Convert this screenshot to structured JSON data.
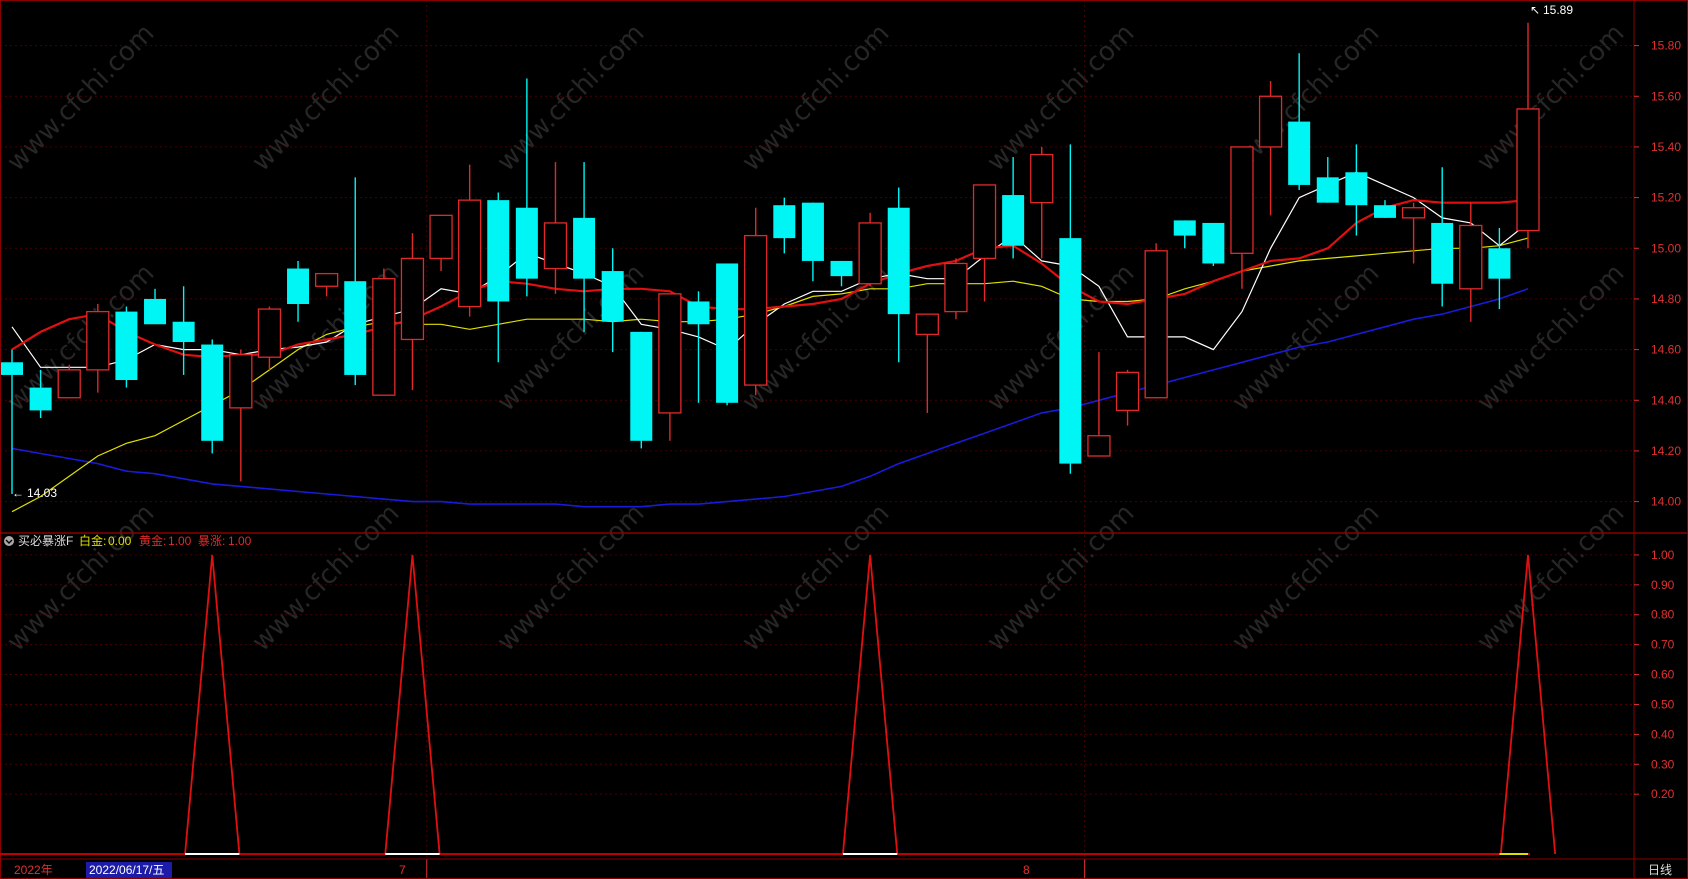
{
  "watermark": "www.cfchi.com",
  "colors": {
    "up": "#e02a2a",
    "down": "#00f5f5",
    "frame": "#8a0000",
    "grid": "#4a0000",
    "ma5": "#ffffff",
    "ma10": "#e01010",
    "ma20": "#e0e000",
    "ma60": "#1a1adb",
    "sig_line": "#e01010",
    "base_line": "#c00000"
  },
  "price_panel": {
    "y_ticks": [
      "15.80",
      "15.60",
      "15.40",
      "15.20",
      "15.00",
      "14.80",
      "14.60",
      "14.40",
      "14.20",
      "14.00"
    ],
    "y_range": [
      13.88,
      15.98
    ],
    "high_annotation": "15.89",
    "low_annotation": "14.03"
  },
  "indicator": {
    "name": "买必暴涨F",
    "items": [
      {
        "label": "白金:",
        "value": "0.00",
        "color": "#e0e000"
      },
      {
        "label": "黄金:",
        "value": "1.00",
        "color": "#e02a2a"
      },
      {
        "label": "暴涨:",
        "value": "1.00",
        "color": "#e02a2a"
      }
    ],
    "y_ticks": [
      "1.00",
      "0.90",
      "0.80",
      "0.70",
      "0.60",
      "0.50",
      "0.40",
      "0.30",
      "0.20"
    ],
    "y_range": [
      0,
      1.07
    ]
  },
  "x_axis": {
    "year_label": "2022年",
    "selected_date": "2022/06/17/五",
    "month_labels": [
      {
        "text": "7",
        "index": 15
      },
      {
        "text": "8",
        "index": 38
      }
    ],
    "period_button": "日线"
  },
  "chart_data": [
    {
      "type": "candlestick",
      "title": "",
      "ylim": [
        13.88,
        15.98
      ],
      "ohlc": [
        [
          14.55,
          14.6,
          14.03,
          14.5
        ],
        [
          14.45,
          14.52,
          14.33,
          14.36
        ],
        [
          14.41,
          14.54,
          14.41,
          14.52
        ],
        [
          14.52,
          14.78,
          14.43,
          14.75
        ],
        [
          14.75,
          14.77,
          14.45,
          14.48
        ],
        [
          14.8,
          14.84,
          14.72,
          14.7
        ],
        [
          14.71,
          14.85,
          14.5,
          14.63
        ],
        [
          14.62,
          14.64,
          14.19,
          14.24
        ],
        [
          14.37,
          14.6,
          14.08,
          14.58
        ],
        [
          14.57,
          14.77,
          14.52,
          14.76
        ],
        [
          14.92,
          14.95,
          14.71,
          14.78
        ],
        [
          14.85,
          14.9,
          14.81,
          14.9
        ],
        [
          14.87,
          15.28,
          14.46,
          14.5
        ],
        [
          14.42,
          14.92,
          14.42,
          14.88
        ],
        [
          14.64,
          15.06,
          14.44,
          14.96
        ],
        [
          14.96,
          15.13,
          14.91,
          15.13
        ],
        [
          14.77,
          15.33,
          14.73,
          15.19
        ],
        [
          15.19,
          15.22,
          14.55,
          14.79
        ],
        [
          15.16,
          15.67,
          14.81,
          14.88
        ],
        [
          14.92,
          15.34,
          14.82,
          15.1
        ],
        [
          15.12,
          15.34,
          14.67,
          14.88
        ],
        [
          14.91,
          15.0,
          14.59,
          14.71
        ],
        [
          14.67,
          14.67,
          14.21,
          14.24
        ],
        [
          14.35,
          14.82,
          14.24,
          14.82
        ],
        [
          14.79,
          14.83,
          14.39,
          14.7
        ],
        [
          14.94,
          14.94,
          14.38,
          14.39
        ],
        [
          14.46,
          15.16,
          14.42,
          15.05
        ],
        [
          15.17,
          15.2,
          14.98,
          15.04
        ],
        [
          15.18,
          15.18,
          14.87,
          14.95
        ],
        [
          14.95,
          14.95,
          14.85,
          14.89
        ],
        [
          14.86,
          15.14,
          14.85,
          15.1
        ],
        [
          15.16,
          15.24,
          14.55,
          14.74
        ],
        [
          14.66,
          14.74,
          14.35,
          14.74
        ],
        [
          14.75,
          14.96,
          14.72,
          14.94
        ],
        [
          14.96,
          15.25,
          14.79,
          15.25
        ],
        [
          15.21,
          15.36,
          14.96,
          15.01
        ],
        [
          15.18,
          15.4,
          14.96,
          15.37
        ],
        [
          15.04,
          15.41,
          14.11,
          14.15
        ],
        [
          14.18,
          14.59,
          14.18,
          14.26
        ],
        [
          14.36,
          14.52,
          14.3,
          14.51
        ],
        [
          14.41,
          15.02,
          14.41,
          14.99
        ],
        [
          15.11,
          15.11,
          15.0,
          15.05
        ],
        [
          15.1,
          15.08,
          14.93,
          14.94
        ],
        [
          14.98,
          15.4,
          14.84,
          15.4
        ],
        [
          15.4,
          15.66,
          15.13,
          15.6
        ],
        [
          15.5,
          15.77,
          15.23,
          15.25
        ],
        [
          15.28,
          15.36,
          15.18,
          15.18
        ],
        [
          15.3,
          15.41,
          15.05,
          15.17
        ],
        [
          15.17,
          15.19,
          15.12,
          15.12
        ],
        [
          15.12,
          15.18,
          14.94,
          15.16
        ],
        [
          15.1,
          15.32,
          14.77,
          14.86
        ],
        [
          14.84,
          15.18,
          14.71,
          15.09
        ],
        [
          15.0,
          15.08,
          14.76,
          14.88
        ],
        [
          15.07,
          15.89,
          15.0,
          15.55
        ]
      ],
      "ma5": [
        14.69,
        14.53,
        14.53,
        14.53,
        14.56,
        14.62,
        14.6,
        14.6,
        14.58,
        14.6,
        14.61,
        14.63,
        14.7,
        14.73,
        14.76,
        14.84,
        14.82,
        14.89,
        14.98,
        14.94,
        14.9,
        14.85,
        14.7,
        14.68,
        14.65,
        14.6,
        14.7,
        14.78,
        14.83,
        14.83,
        14.88,
        14.9,
        14.88,
        14.88,
        14.97,
        15.05,
        14.95,
        14.93,
        14.85,
        14.65,
        14.65,
        14.65,
        14.6,
        14.75,
        15.0,
        15.2,
        15.25,
        15.3,
        15.25,
        15.2,
        15.12,
        15.1,
        15.01,
        15.1
      ],
      "ma10": [
        14.6,
        14.67,
        14.72,
        14.74,
        14.67,
        14.62,
        14.58,
        14.57,
        14.58,
        14.58,
        14.62,
        14.64,
        14.66,
        14.69,
        14.72,
        14.77,
        14.83,
        14.87,
        14.86,
        14.84,
        14.83,
        14.84,
        14.84,
        14.83,
        14.77,
        14.76,
        14.76,
        14.77,
        14.78,
        14.8,
        14.86,
        14.9,
        14.93,
        14.95,
        15.0,
        15.01,
        14.94,
        14.85,
        14.79,
        14.78,
        14.8,
        14.82,
        14.87,
        14.91,
        14.95,
        14.96,
        15.0,
        15.1,
        15.16,
        15.19,
        15.18,
        15.18,
        15.18,
        15.19
      ],
      "ma20": [
        13.96,
        14.02,
        14.1,
        14.18,
        14.23,
        14.26,
        14.32,
        14.38,
        14.44,
        14.52,
        14.6,
        14.66,
        14.69,
        14.71,
        14.7,
        14.7,
        14.68,
        14.7,
        14.72,
        14.72,
        14.72,
        14.71,
        14.72,
        14.71,
        14.71,
        14.72,
        14.74,
        14.77,
        14.81,
        14.82,
        14.84,
        14.84,
        14.86,
        14.86,
        14.86,
        14.87,
        14.85,
        14.8,
        14.79,
        14.79,
        14.8,
        14.84,
        14.87,
        14.91,
        14.93,
        14.95,
        14.96,
        14.97,
        14.98,
        14.99,
        15.0,
        15.0,
        15.01,
        15.04
      ],
      "ma60": [
        14.21,
        14.19,
        14.17,
        14.15,
        14.12,
        14.11,
        14.09,
        14.07,
        14.06,
        14.05,
        14.04,
        14.03,
        14.02,
        14.01,
        14.0,
        14.0,
        13.99,
        13.99,
        13.99,
        13.99,
        13.98,
        13.98,
        13.98,
        13.99,
        13.99,
        14.0,
        14.01,
        14.02,
        14.04,
        14.06,
        14.1,
        14.15,
        14.19,
        14.23,
        14.27,
        14.31,
        14.35,
        14.37,
        14.4,
        14.43,
        14.46,
        14.49,
        14.52,
        14.55,
        14.58,
        14.61,
        14.63,
        14.66,
        14.69,
        14.72,
        14.74,
        14.77,
        14.8,
        14.84
      ]
    },
    {
      "type": "line",
      "title": "买必暴涨F",
      "ylim": [
        0,
        1.07
      ],
      "series": [
        {
          "name": "暴涨",
          "values": [
            0,
            0,
            0,
            0,
            0,
            0,
            0,
            1,
            0,
            0,
            0,
            0,
            0,
            0,
            1,
            0,
            0,
            0,
            0,
            0,
            0,
            0,
            0,
            0,
            0,
            0,
            0,
            0,
            0,
            0,
            1,
            0,
            0,
            0,
            0,
            0,
            0,
            0,
            0,
            0,
            0,
            0,
            0,
            0,
            0,
            0,
            0,
            0,
            0,
            0,
            0,
            0,
            0,
            1
          ]
        }
      ]
    }
  ]
}
